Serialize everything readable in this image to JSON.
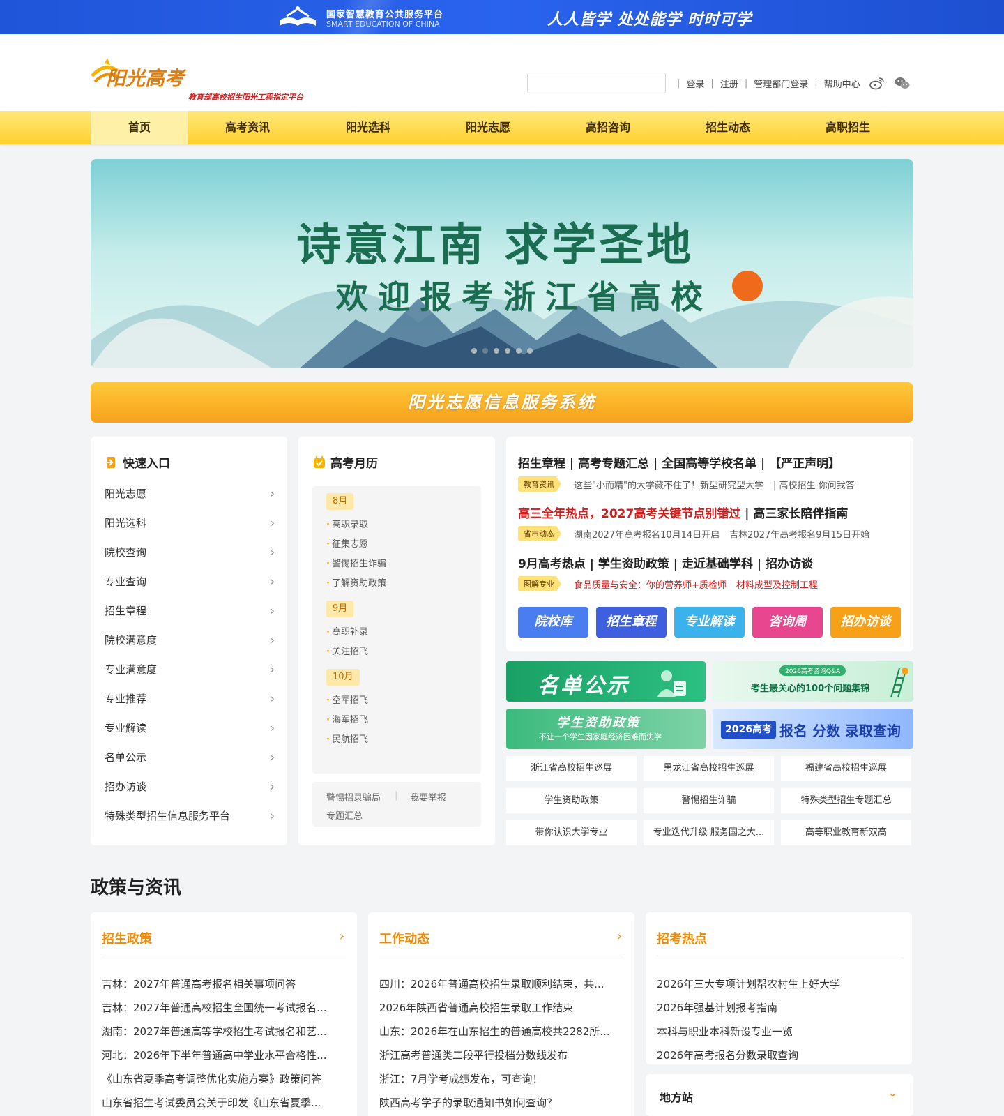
{
  "topbar": {
    "platform_cn": "国家智慧教育公共服务平台",
    "platform_en": "SMART EDUCATION OF CHINA",
    "slogan": "人人皆学 处处能学 时时可学"
  },
  "header": {
    "brand_name": "阳光高考",
    "brand_tagline": "教育部高校招生阳光工程指定平台",
    "search_placeholder": "",
    "links": [
      "登录",
      "注册",
      "管理部门登录",
      "帮助中心"
    ]
  },
  "nav": {
    "items": [
      "首页",
      "高考资讯",
      "阳光选科",
      "阳光志愿",
      "高招咨询",
      "招生动态",
      "高职招生"
    ],
    "active_index": 0
  },
  "hero": {
    "line1": "诗意江南  求学圣地",
    "line2": "欢迎报考浙江省高校",
    "slide_count": 6,
    "active_slide": 1
  },
  "system_bar": "阳光志愿信息服务系统",
  "quick_entry": {
    "title": "快速入口",
    "items": [
      "阳光志愿",
      "阳光选科",
      "院校查询",
      "专业查询",
      "招生章程",
      "院校满意度",
      "专业满意度",
      "专业推荐",
      "专业解读",
      "名单公示",
      "招办访谈",
      "特殊类型招生信息服务平台"
    ]
  },
  "calendar": {
    "title": "高考月历",
    "months": [
      {
        "label": "8月",
        "events": [
          "高职录取",
          "征集志愿",
          "警惕招生诈骗",
          "了解资助政策"
        ]
      },
      {
        "label": "9月",
        "events": [
          "高职补录",
          "关注招飞"
        ]
      },
      {
        "label": "10月",
        "events": [
          "空军招飞",
          "海军招飞",
          "民航招飞"
        ]
      }
    ],
    "footer_links": [
      "警惕招录骗局",
      "我要举报",
      "专题汇总"
    ]
  },
  "news": {
    "row1": "招生章程 | 高考专题汇总 | 全国高等学校名单 | 【严正声明】",
    "row1_tag": "教育资讯",
    "row1_sub_a": "这些\"小而精\"的大学藏不住了！新型研究型大学",
    "row1_sub_b": "| 高校招生 你问我答",
    "row2_red": "高三全年热点，2027高考关键节点别错过",
    "row2_rest": " | 高三家长陪伴指南",
    "row2_tag": "省市动态",
    "row2_sub_a": "湖南2027年高考报名10月14日开启",
    "row2_sub_b": "吉林2027年高考报名9月15日开始",
    "row3": "9月高考热点 | 学生资助政策 | 走近基础学科 | 招办访谈",
    "row3_tag": "图解专业",
    "row3_sub_a": "食品质量与安全：你的营养师+质检师",
    "row3_sub_b": "材料成型及控制工程",
    "buttons": [
      {
        "label": "院校库",
        "color": "#4a7ef0"
      },
      {
        "label": "招生章程",
        "color": "#3d5fe0"
      },
      {
        "label": "专业解读",
        "color": "#3bb2ec"
      },
      {
        "label": "咨询周",
        "color": "#e8468f"
      },
      {
        "label": "招办访谈",
        "color": "#f7a119"
      }
    ]
  },
  "promos": {
    "list_publicity": "名单公示",
    "qa_badge": "2026高考咨询Q&A",
    "qa_text": "考生最关心的100个问题集锦",
    "aid_title": "学生资助政策",
    "aid_sub": "不让一个学生因家庭经济困难而失学",
    "gaokao_year": "2026高考",
    "gaokao_text": "报名 分数 录取查询"
  },
  "links_grid": [
    "浙江省高校招生巡展",
    "黑龙江省高校招生巡展",
    "福建省高校招生巡展",
    "学生资助政策",
    "警惕招生诈骗",
    "特殊类型招生专题汇总",
    "带你认识大学专业",
    "专业迭代升级 服务国之大...",
    "高等职业教育新双高"
  ],
  "policy": {
    "section_title": "政策与资讯",
    "columns": [
      {
        "title": "招生政策",
        "more": "›",
        "items": [
          "吉林：2027年普通高考报名相关事项问答",
          "吉林：2027年普通高校招生全国统一考试报名...",
          "湖南：2027年普通高等学校招生考试报名和艺...",
          "河北：2026年下半年普通高中学业水平合格性...",
          "《山东省夏季高考调整优化实施方案》政策问答",
          "山东省招生考试委员会关于印发《山东省夏季..."
        ]
      },
      {
        "title": "工作动态",
        "more": "›",
        "items": [
          "四川：2026年普通高校招生录取顺利结束，共...",
          "2026年陕西省普通高校招生录取工作结束",
          "山东：2026年在山东招生的普通高校共2282所...",
          "浙江高考普通类二段平行投档分数线发布",
          "浙江：7月学考成绩发布，可查询！",
          "陕西高考学子的录取通知书如何查询？"
        ]
      },
      {
        "title": "招考热点",
        "more": "",
        "items": [
          "2026年三大专项计划帮农村生上好大学",
          "2026年强基计划报考指南",
          "本科与职业本科新设专业一览",
          "2026年高考报名分数录取查询"
        ]
      }
    ],
    "local_station": "地方站",
    "local_chevron": "⌄"
  }
}
